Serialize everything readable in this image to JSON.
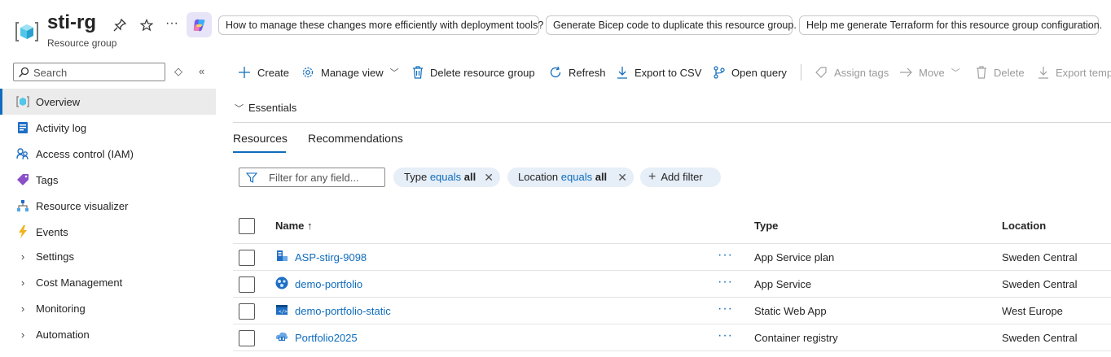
{
  "header": {
    "title": "sti-rg",
    "subtitle": "Resource group",
    "more": "···",
    "suggestions": [
      "How to manage these changes more efficiently with deployment tools?",
      "Generate Bicep code to duplicate this resource group.",
      "Help me generate Terraform for this resource group configuration."
    ]
  },
  "sidebar": {
    "search_placeholder": "Search",
    "items": [
      {
        "label": "Overview",
        "icon": "resource-group-icon",
        "active": true
      },
      {
        "label": "Activity log",
        "icon": "activity-log-icon"
      },
      {
        "label": "Access control (IAM)",
        "icon": "iam-icon"
      },
      {
        "label": "Tags",
        "icon": "tag-icon"
      },
      {
        "label": "Resource visualizer",
        "icon": "visualizer-icon"
      },
      {
        "label": "Events",
        "icon": "lightning-icon"
      },
      {
        "label": "Settings",
        "icon": "chevron-right-icon"
      },
      {
        "label": "Cost Management",
        "icon": "chevron-right-icon"
      },
      {
        "label": "Monitoring",
        "icon": "chevron-right-icon"
      },
      {
        "label": "Automation",
        "icon": "chevron-right-icon"
      }
    ]
  },
  "toolbar": {
    "create": "Create",
    "manage_view": "Manage view",
    "delete_rg": "Delete resource group",
    "refresh": "Refresh",
    "export_csv": "Export to CSV",
    "open_query": "Open query",
    "assign_tags": "Assign tags",
    "move": "Move",
    "delete": "Delete",
    "export_template": "Export temp"
  },
  "essentials": {
    "label": "Essentials"
  },
  "tabs": [
    "Resources",
    "Recommendations"
  ],
  "filters": {
    "placeholder": "Filter for any field...",
    "type": {
      "key": "Type",
      "op": "equals",
      "value": "all"
    },
    "location": {
      "key": "Location",
      "op": "equals",
      "value": "all"
    },
    "add": "Add filter"
  },
  "table": {
    "columns": {
      "name": "Name ↑",
      "type": "Type",
      "location": "Location"
    },
    "more": "···",
    "rows": [
      {
        "name": "ASP-stirg-9098",
        "type": "App Service plan",
        "location": "Sweden Central",
        "icon": "app-service-plan-icon"
      },
      {
        "name": "demo-portfolio",
        "type": "App Service",
        "location": "Sweden Central",
        "icon": "app-service-icon"
      },
      {
        "name": "demo-portfolio-static",
        "type": "Static Web App",
        "location": "West Europe",
        "icon": "static-web-app-icon"
      },
      {
        "name": "Portfolio2025",
        "type": "Container registry",
        "location": "Sweden Central",
        "icon": "container-registry-icon"
      }
    ]
  },
  "colors": {
    "accent": "#0f6cbd",
    "chip_bg": "#e6eef7",
    "active_nav_bg": "#ebebeb"
  }
}
